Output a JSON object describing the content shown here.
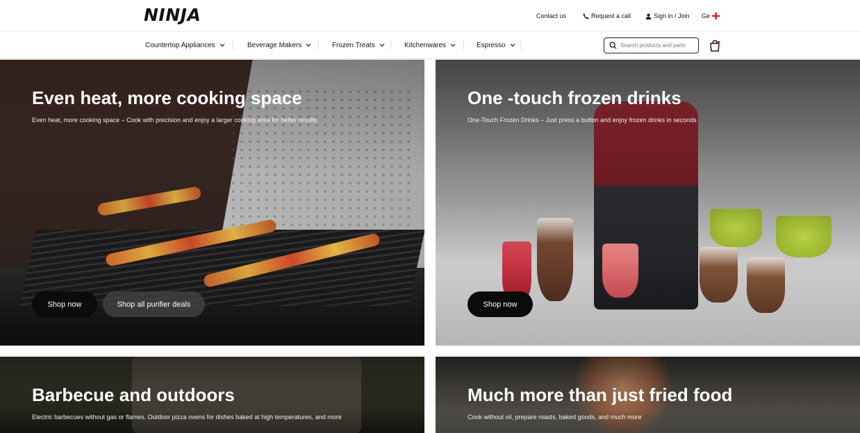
{
  "brand": {
    "logo_text": "NINJA"
  },
  "utility_links": [
    {
      "label": "Contact us",
      "icon": ""
    },
    {
      "label": "Request a call",
      "icon": "phone-icon"
    },
    {
      "label": "Sign in / Join",
      "icon": "user-icon"
    },
    {
      "label": "Ge",
      "icon": "flag-icon"
    }
  ],
  "nav": {
    "items": [
      {
        "label": "Countertop Appliances"
      },
      {
        "label": "Beverage Makers"
      },
      {
        "label": "Frozen Treats"
      },
      {
        "label": "Kitchenwares"
      },
      {
        "label": "Espresso"
      }
    ],
    "search": {
      "placeholder": "Search products and parts"
    }
  },
  "tiles": [
    {
      "title": "Even heat, more cooking space",
      "subtitle": "Even heat, more cooking space – Cook with precision and enjoy a larger cooking area for better results",
      "buttons": [
        {
          "label": "Shop now"
        },
        {
          "label": "Shop all purifier deals"
        }
      ]
    },
    {
      "title": "One -touch frozen drinks",
      "subtitle": "One-Touch Frozen Drinks – Just press a button and enjoy frozen drinks in seconds",
      "buttons": [
        {
          "label": "Shop now"
        }
      ]
    },
    {
      "title": "Barbecue and outdoors",
      "subtitle": "Electric barbecues without gas or flames. Outdoor pizza ovens for dishes baked at high temperatures, and more"
    },
    {
      "title": "Much more than just fried food",
      "subtitle": "Cook without oil, prepare roasts, baked goods, and much more"
    }
  ],
  "colors": {
    "button_dark": "#0b0b0b",
    "flag_red": "#e02424",
    "text_white": "#ffffff"
  }
}
